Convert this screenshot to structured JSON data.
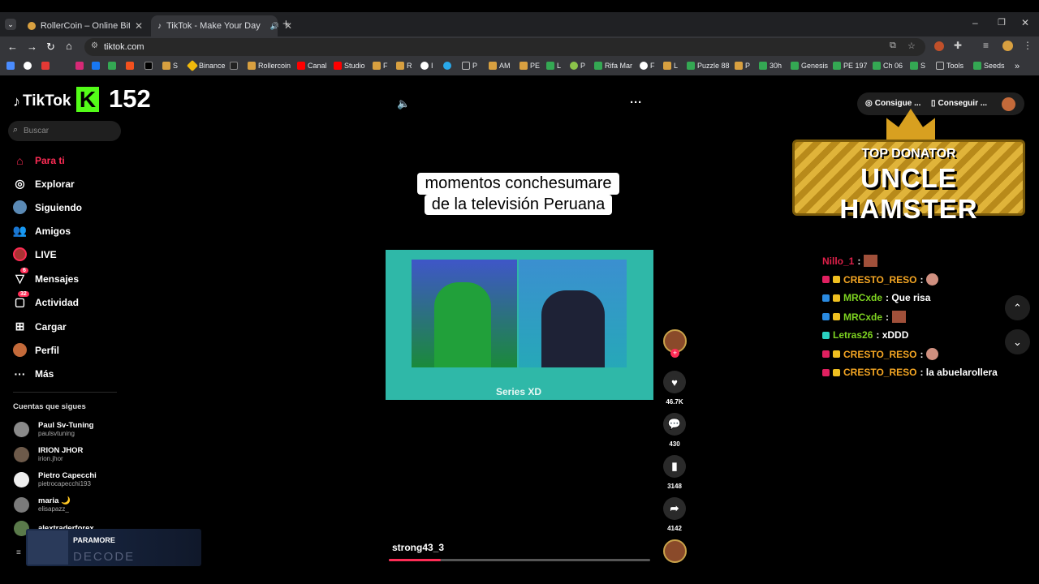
{
  "browser": {
    "tabs": [
      {
        "title": "RollerCoin – Online Bitcoin Mi",
        "active": false
      },
      {
        "title": "TikTok - Make Your Day",
        "active": true
      }
    ],
    "url": "tiktok.com",
    "bookmarks": [
      "S",
      "Binance",
      "Rollercoin",
      "Canal",
      "Studio",
      "F",
      "R",
      "I",
      "P",
      "AM",
      "PE",
      "L",
      "P",
      "Rifa Mar",
      "F",
      "L",
      "Puzzle 88",
      "P",
      "30h",
      "Genesis",
      "PE 197",
      "Ch 06",
      "S",
      "Tools",
      "Seeds"
    ]
  },
  "overlay": {
    "k_count": "152"
  },
  "tiktok": {
    "logo": "TikTok",
    "search_placeholder": "Buscar",
    "nav": [
      {
        "label": "Para ti",
        "icon": "home-icon",
        "active": true
      },
      {
        "label": "Explorar",
        "icon": "compass-icon"
      },
      {
        "label": "Siguiendo",
        "icon": "following-icon"
      },
      {
        "label": "Amigos",
        "icon": "friends-icon"
      },
      {
        "label": "LIVE",
        "icon": "live-icon"
      },
      {
        "label": "Mensajes",
        "icon": "messages-icon",
        "badge": "6"
      },
      {
        "label": "Actividad",
        "icon": "activity-icon",
        "badge": "32"
      },
      {
        "label": "Cargar",
        "icon": "upload-icon"
      },
      {
        "label": "Perfil",
        "icon": "profile-icon"
      },
      {
        "label": "Más",
        "icon": "more-icon"
      }
    ],
    "following_title": "Cuentas que sigues",
    "following": [
      {
        "name": "Paul Sv-Tuning",
        "handle": "paulsvtuning"
      },
      {
        "name": "IRION JHOR",
        "handle": "irion.jhor"
      },
      {
        "name": "Pietro Capecchi",
        "handle": "pietrocapecchi193"
      },
      {
        "name": "maria 🌙",
        "handle": "elisapazz_"
      },
      {
        "name": "alextraderforex",
        "handle": ""
      }
    ],
    "music_overlay": {
      "artist": "PARAMORE",
      "album": "DECODE"
    },
    "video": {
      "caption_line1": "momentos conchesumare",
      "caption_line2": "de la televisión Peruana",
      "watermark": "Series XD",
      "author": "strong43_3",
      "progress": 0.2
    },
    "actions": {
      "likes": "46.7K",
      "comments": "430",
      "saves": "3148",
      "shares": "4142"
    },
    "top_buttons": [
      "Consigue ...",
      "Conseguir ..."
    ],
    "donator": {
      "title": "TOP DONATOR",
      "name": "UNCLE HAMSTER"
    },
    "chat": [
      {
        "user": "Nillo_1",
        "msg": ":",
        "color": "#e0204a"
      },
      {
        "user": "CRESTO_RESO",
        "msg": ":",
        "color": "#f5a623"
      },
      {
        "user": "MRCxde",
        "msg": ": Que risa",
        "color": "#7ed321"
      },
      {
        "user": "MRCxde",
        "msg": ":",
        "color": "#7ed321"
      },
      {
        "user": "Letras26",
        "msg": ": xDDD",
        "color": "#7ed321"
      },
      {
        "user": "CRESTO_RESO",
        "msg": ":",
        "color": "#f5a623"
      },
      {
        "user": "CRESTO_RESO",
        "msg": ": la abuelarollera",
        "color": "#f5a623"
      }
    ]
  },
  "colors": {
    "accent": "#fe2c55",
    "chrome": "#35363a"
  }
}
